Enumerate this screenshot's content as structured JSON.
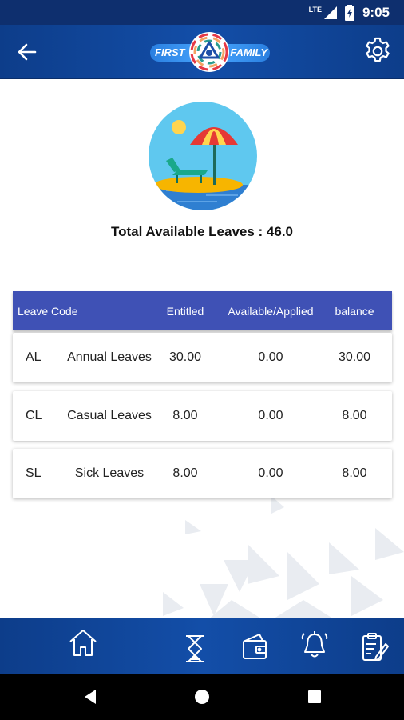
{
  "status_bar": {
    "network": "LTE",
    "time": "9:05"
  },
  "app_bar": {
    "logo_left": "FIRST",
    "logo_right": "FAMILY",
    "back_icon": "arrow-back-icon",
    "settings_icon": "gear-icon"
  },
  "summary": {
    "total_label": "Total Available Leaves : 46.0"
  },
  "table": {
    "headers": {
      "code": "Leave Code",
      "entitled": "Entitled",
      "available": "Available/Applied",
      "balance": "balance"
    },
    "rows": [
      {
        "code": "AL",
        "name": "Annual Leaves",
        "entitled": "30.00",
        "available": "0.00",
        "balance": "30.00"
      },
      {
        "code": "CL",
        "name": "Casual Leaves",
        "entitled": "8.00",
        "available": "0.00",
        "balance": "8.00"
      },
      {
        "code": "SL",
        "name": "Sick Leaves",
        "entitled": "8.00",
        "available": "0.00",
        "balance": "8.00"
      }
    ]
  },
  "bottom_nav": {
    "items": [
      "home-icon",
      "hourglass-icon",
      "wallet-icon",
      "bell-icon",
      "clipboard-edit-icon"
    ]
  },
  "colors": {
    "primary": "#134ea8",
    "table_header": "#3f51b5",
    "status_bar": "#0e2f6e"
  }
}
